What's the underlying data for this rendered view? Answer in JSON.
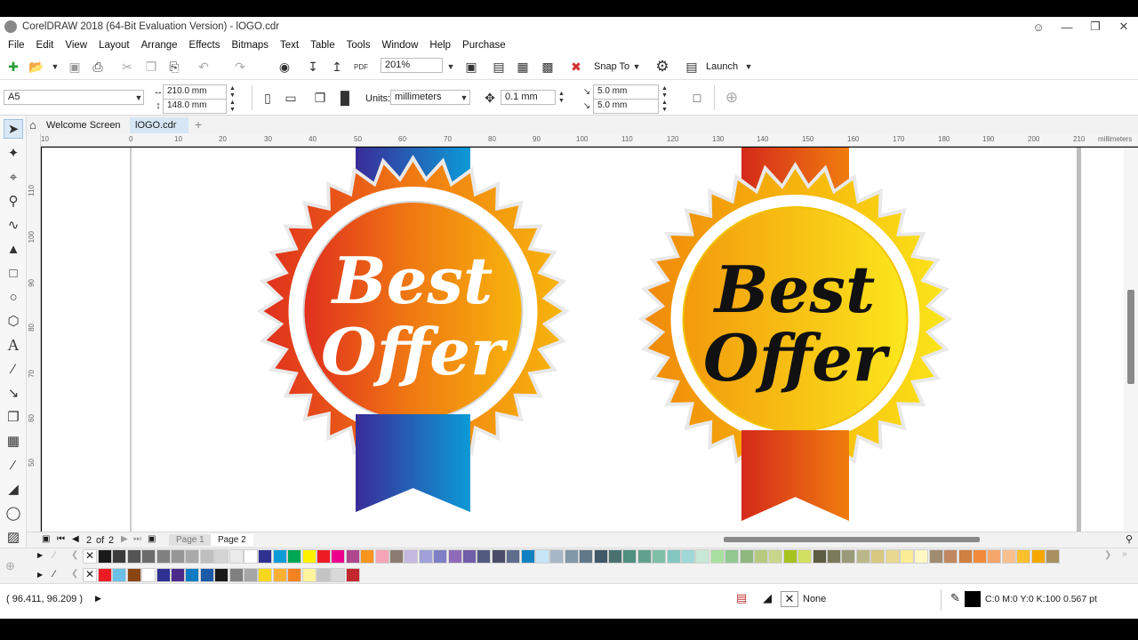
{
  "titlebar": {
    "title": "CorelDRAW 2018 (64-Bit Evaluation Version) - lOGO.cdr"
  },
  "menu": [
    "File",
    "Edit",
    "View",
    "Layout",
    "Arrange",
    "Effects",
    "Bitmaps",
    "Text",
    "Table",
    "Tools",
    "Window",
    "Help",
    "Purchase"
  ],
  "toolbar": {
    "zoom": "201%",
    "snap_label": "Snap To",
    "launch_label": "Launch"
  },
  "property_bar": {
    "page_size": "A5",
    "width": "210.0 mm",
    "height": "148.0 mm",
    "units_label": "Units:",
    "units_value": "millimeters",
    "nudge": "0.1 mm",
    "dup_x": "5.0 mm",
    "dup_y": "5.0 mm"
  },
  "tabs": {
    "welcome": "Welcome Screen",
    "doc": "lOGO.cdr"
  },
  "ruler": {
    "h_labels": [
      "10",
      "0",
      "10",
      "20",
      "30",
      "40",
      "50",
      "60",
      "70",
      "80",
      "90",
      "100",
      "110",
      "120",
      "130",
      "140",
      "150",
      "160",
      "170",
      "180",
      "190",
      "200",
      "210"
    ],
    "unit": "millimeters",
    "v_labels": [
      "110",
      "100",
      "90",
      "80",
      "70",
      "60",
      "50"
    ]
  },
  "badges": [
    {
      "line1": "Best",
      "line2": "Offer"
    },
    {
      "line1": "Best",
      "line2": "Offer"
    }
  ],
  "pages": {
    "current": "2",
    "of_label": "of",
    "total": "2",
    "page1": "Page 1",
    "page2": "Page 2"
  },
  "palette_row1": [
    "#1a1a1a",
    "#3c3c3c",
    "#555",
    "#6b6b6b",
    "#808080",
    "#969696",
    "#aaaaaa",
    "#bfbfbf",
    "#d4d4d4",
    "#ebebeb",
    "#ffffff",
    "#2e3192",
    "#0f9ad8",
    "#00a651",
    "#fff200",
    "#ed1c24",
    "#ec008c",
    "#b0468e",
    "#f7941d",
    "#f6a4b8",
    "#8c7b70",
    "#c4b8e0",
    "#a09fd8",
    "#7f7fc6",
    "#8e6bb8",
    "#6f5da8",
    "#525a80",
    "#4b4b6a",
    "#5e6c8e",
    "#0f80c0",
    "#c6e6f8",
    "#a6b8c8",
    "#8098a8",
    "#607888",
    "#405868",
    "#4a7070",
    "#4f8f7f",
    "#62a08e",
    "#7fbfa8",
    "#84c7c0",
    "#a0d8d8",
    "#c8e8d8",
    "#a8e0a0",
    "#90c890",
    "#8fb87f",
    "#b7c97f",
    "#c8d68c",
    "#a6c21f",
    "#d1e060",
    "#5c5c40",
    "#7a7a5a",
    "#9a9a7a",
    "#bab88a",
    "#d8c880",
    "#e8d890",
    "#fcec96",
    "#fff8c4",
    "#a08c70",
    "#c08860",
    "#d08040",
    "#f28a3c",
    "#f7a66b",
    "#f9c08f",
    "#fcbf2e",
    "#f6a800",
    "#a89060"
  ],
  "palette_row2": [
    "#ed1c24",
    "#6cc0e5",
    "#8b4513",
    "#ffffff",
    "#2e3192",
    "#4b2a8c",
    "#0f7bc0",
    "#1a5aa8",
    "#1a1a1a",
    "#808080",
    "#a6a6a6",
    "#f9d71c",
    "#fbb034",
    "#f58220",
    "#fff59d",
    "#c4c4c4",
    "#d9d9d9",
    "#c1272d"
  ],
  "status": {
    "coords": "( 96.411, 96.209 )",
    "fill_label": "None",
    "outline_label": "C:0 M:0 Y:0 K:100  0.567 pt"
  }
}
